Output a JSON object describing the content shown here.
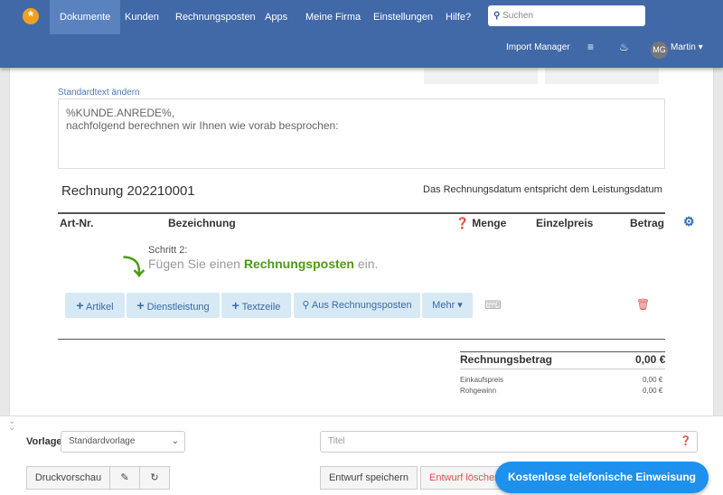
{
  "nav": {
    "items": [
      "Dokumente",
      "Kunden",
      "Rechnungsposten",
      "Apps",
      "Meine Firma",
      "Einstellungen",
      "Hilfe?"
    ],
    "search_placeholder": "Suchen",
    "import_manager": "Import Manager",
    "avatar_initials": "MG",
    "user": "Martin"
  },
  "doc": {
    "standardtext_link": "Standardtext ändern",
    "text_line1": "%KUNDE.ANREDE%,",
    "text_line2": "nachfolgend berechnen wir Ihnen wie vorab besprochen:",
    "title": "Rechnung 202210001",
    "date_note": "Das Rechnungsdatum entspricht dem Leistungsdatum"
  },
  "table": {
    "headers": [
      "Art-Nr.",
      "Bezeichnung",
      "Menge",
      "Einzelpreis",
      "Betrag"
    ]
  },
  "hint": {
    "step": "Schritt 2:",
    "pre": "Fügen Sie einen",
    "highlight": "Rechnungsposten",
    "post": "ein."
  },
  "buttons": {
    "artikel": "Artikel",
    "dienstleistung": "Dienstleistung",
    "textzeile": "Textzeile",
    "aus": "Aus Rechnungsposten",
    "mehr": "Mehr"
  },
  "totals": {
    "label": "Rechnungsbetrag",
    "value": "0,00 €",
    "einkauf_label": "Einkaufspreis",
    "einkauf_value": "0,00 €",
    "rohgewinn_label": "Rohgewinn",
    "rohgewinn_value": "0,00 €"
  },
  "footer": {
    "vorlage_label": "Vorlage",
    "vorlage_value": "Standardvorlage",
    "title_placeholder": "Titel",
    "preview": "Druckvorschau",
    "save": "Entwurf speichern",
    "delete": "Entwurf löschen",
    "cta": "Kostenlose telefonische Einweisung"
  }
}
